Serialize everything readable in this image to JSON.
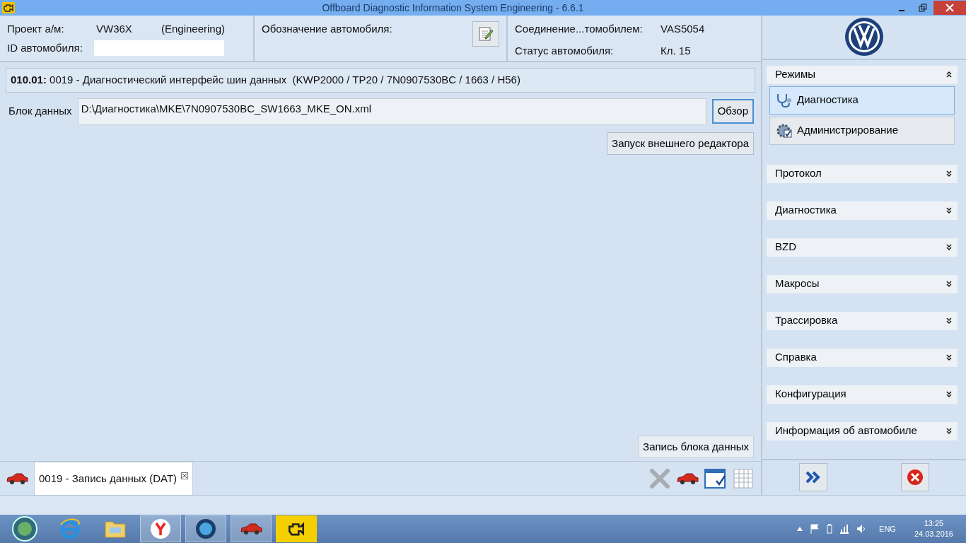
{
  "window": {
    "title": "Offboard Diagnostic Information System Engineering - 6.6.1"
  },
  "header": {
    "project_label": "Проект а/м:",
    "project_value": "VW36X",
    "project_mode": "(Engineering)",
    "vehicle_id_label": "ID автомобиля:",
    "designation_label": "Обозначение автомобиля:",
    "connection_label": "Соединение...томобилем:",
    "connection_value": "VAS5054",
    "status_label": "Статус автомобиля:",
    "status_value": "Кл. 15"
  },
  "control_unit": {
    "code": "010.01:",
    "description": "0019 - Диагностический интерфейс шин данных  (KWP2000 / TP20 / 7N0907530BC / 1663 / H56)"
  },
  "data_block": {
    "label": "Блок данных",
    "value": "D:\\Диагностика\\MKE\\7N0907530BC_SW1663_MKE_ON.xml",
    "browse_button": "Обзор"
  },
  "editor_button": "Запуск внешнего редактора",
  "write_button": "Запись блока данных",
  "document_tabs": [
    {
      "label": "0019 - Запись данных (DAT)",
      "selected": true
    }
  ],
  "sidebar": [
    {
      "title": "Режимы",
      "expanded": true,
      "items": [
        {
          "label": "Диагностика",
          "kind": "stethoscope",
          "selected": true
        },
        {
          "label": "Администрирование",
          "kind": "gear",
          "selected": false
        }
      ]
    },
    {
      "title": "Протокол",
      "expanded": false
    },
    {
      "title": "Диагностика",
      "expanded": false
    },
    {
      "title": "BZD",
      "expanded": false
    },
    {
      "title": "Макросы",
      "expanded": false
    },
    {
      "title": "Трассировка",
      "expanded": false
    },
    {
      "title": "Справка",
      "expanded": false
    },
    {
      "title": "Конфигурация",
      "expanded": false
    },
    {
      "title": "Информация об автомобиле",
      "expanded": false
    }
  ],
  "taskbar": {
    "language": "ENG",
    "time": "13:25",
    "date": "24.03.2016"
  }
}
